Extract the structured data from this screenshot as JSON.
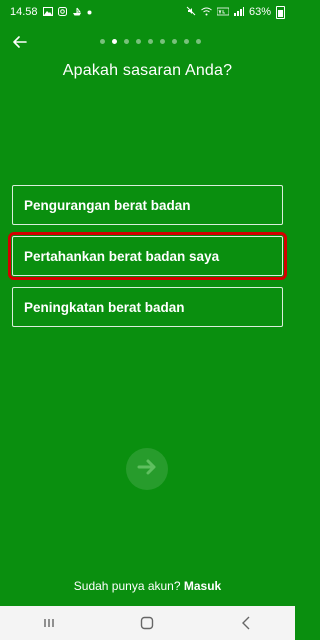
{
  "status_bar": {
    "time": "14.58",
    "battery": "63%",
    "notification_icons": [
      "image-icon",
      "instagram-icon",
      "boat-icon",
      "dot-icon"
    ],
    "system_icons": [
      "mute-icon",
      "wifi-icon",
      "volte-icon",
      "signal-icon",
      "battery-icon"
    ]
  },
  "nav": {
    "back_icon": "arrow-left-icon",
    "progress": {
      "total_steps": 9,
      "current_step": 2
    }
  },
  "question": "Apakah sasaran Anda?",
  "options": [
    {
      "label": "Pengurangan berat badan"
    },
    {
      "label": "Pertahankan berat badan saya"
    },
    {
      "label": "Peningkatan berat badan"
    }
  ],
  "next_button": {
    "icon": "arrow-right-icon"
  },
  "login_prompt": {
    "text": "Sudah punya akun?",
    "link": "Masuk"
  },
  "colors": {
    "background": "#0a8f0f",
    "highlight_box": "#d40000",
    "next_arrow": "#5fbf5f"
  },
  "android_nav": {
    "icons": [
      "recents-icon",
      "home-icon",
      "back-icon"
    ]
  }
}
